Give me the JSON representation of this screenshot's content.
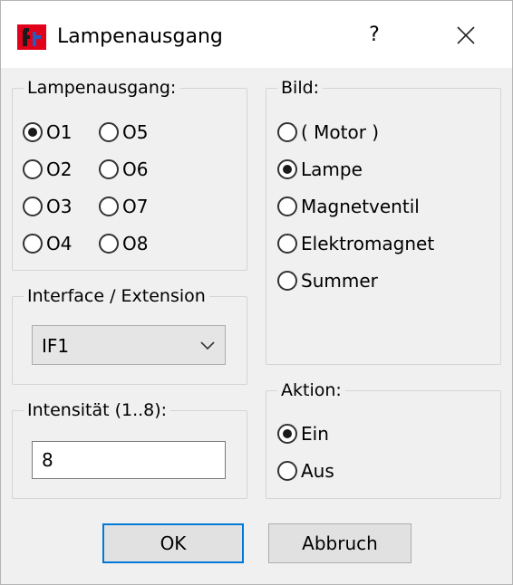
{
  "window": {
    "title": "Lampenausgang",
    "help_label": "?"
  },
  "lampenausgang": {
    "title": "Lampenausgang:",
    "options": [
      {
        "label": "O1",
        "checked": true
      },
      {
        "label": "O5",
        "checked": false
      },
      {
        "label": "O2",
        "checked": false
      },
      {
        "label": "O6",
        "checked": false
      },
      {
        "label": "O3",
        "checked": false
      },
      {
        "label": "O7",
        "checked": false
      },
      {
        "label": "O4",
        "checked": false
      },
      {
        "label": "O8",
        "checked": false
      }
    ]
  },
  "bild": {
    "title": "Bild:",
    "options": [
      {
        "label": "( Motor )",
        "checked": false
      },
      {
        "label": "Lampe",
        "checked": true
      },
      {
        "label": "Magnetventil",
        "checked": false
      },
      {
        "label": "Elektromagnet",
        "checked": false
      },
      {
        "label": "Summer",
        "checked": false
      }
    ]
  },
  "interface": {
    "title": "Interface / Extension",
    "selected": "IF1"
  },
  "intensitaet": {
    "title": "Intensität (1..8):",
    "value": "8"
  },
  "aktion": {
    "title": "Aktion:",
    "options": [
      {
        "label": "Ein",
        "checked": true
      },
      {
        "label": "Aus",
        "checked": false
      }
    ]
  },
  "buttons": {
    "ok": "OK",
    "cancel": "Abbruch"
  },
  "colors": {
    "accent": "#0078d7",
    "logo_red": "#e2001a",
    "logo_blue": "#1f5fbf"
  }
}
